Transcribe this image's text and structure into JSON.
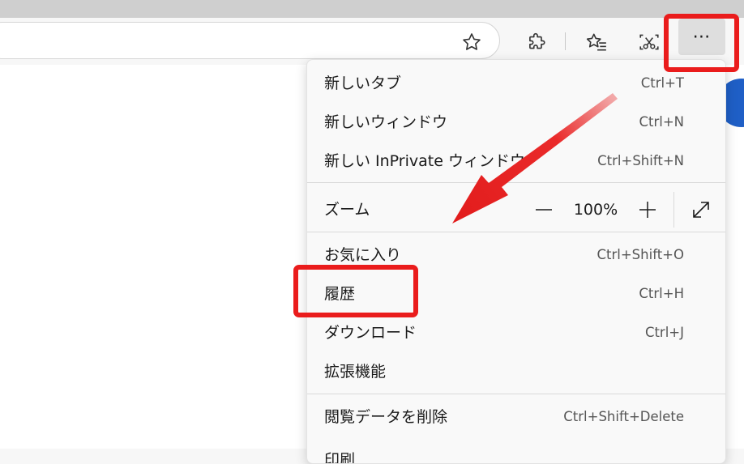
{
  "toolbar": {
    "icons": [
      "star-icon",
      "puzzle-icon",
      "favorites-icon",
      "web-capture-icon"
    ],
    "more_label": "⋯"
  },
  "menu": {
    "new_tab": {
      "label": "新しいタブ",
      "shortcut": "Ctrl+T"
    },
    "new_window": {
      "label": "新しいウィンドウ",
      "shortcut": "Ctrl+N"
    },
    "new_inprivate": {
      "label": "新しい InPrivate ウィンドウ",
      "shortcut": "Ctrl+Shift+N"
    },
    "zoom": {
      "label": "ズーム",
      "value": "100%",
      "minus": "—",
      "plus": "+"
    },
    "favorites": {
      "label": "お気に入り",
      "shortcut": "Ctrl+Shift+O"
    },
    "history": {
      "label": "履歴",
      "shortcut": "Ctrl+H"
    },
    "downloads": {
      "label": "ダウンロード",
      "shortcut": "Ctrl+J"
    },
    "extensions": {
      "label": "拡張機能"
    },
    "clear_data": {
      "label": "閲覧データを削除",
      "shortcut": "Ctrl+Shift+Delete"
    },
    "print": {
      "label": "印刷"
    }
  },
  "colors": {
    "highlight": "#ea1c1c",
    "accent_blue": "#1f5fc6"
  }
}
